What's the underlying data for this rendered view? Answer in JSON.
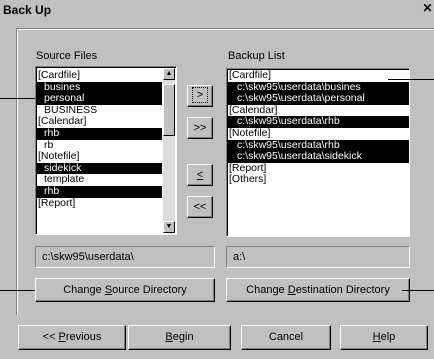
{
  "window": {
    "title": "Back Up",
    "close_glyph": "✕"
  },
  "source": {
    "label": "Source Files",
    "items": [
      {
        "text": "[Cardfile]",
        "selected": false,
        "indent": 0
      },
      {
        "text": "busines",
        "selected": true,
        "indent": 1
      },
      {
        "text": "personal",
        "selected": true,
        "indent": 1
      },
      {
        "text": "BUSINESS",
        "selected": false,
        "indent": 1
      },
      {
        "text": "[Calendar]",
        "selected": false,
        "indent": 0
      },
      {
        "text": "rhb",
        "selected": true,
        "indent": 1
      },
      {
        "text": "rb",
        "selected": false,
        "indent": 1
      },
      {
        "text": "[Notefile]",
        "selected": false,
        "indent": 0
      },
      {
        "text": "sidekick",
        "selected": true,
        "indent": 1
      },
      {
        "text": "template",
        "selected": false,
        "indent": 1
      },
      {
        "text": "rhb",
        "selected": true,
        "indent": 1
      },
      {
        "text": "[Report]",
        "selected": false,
        "indent": 0
      }
    ],
    "path": "c:\\skw95\\userdata\\",
    "change_button": {
      "before": "Change ",
      "underline": "S",
      "after": "ource Directory"
    }
  },
  "backup": {
    "label": "Backup List",
    "items": [
      {
        "text": "[Cardfile]",
        "selected": false,
        "indent": 0
      },
      {
        "text": "c:\\skw95\\userdata\\busines",
        "selected": true,
        "indent": 2
      },
      {
        "text": "c:\\skw95\\userdata\\personal",
        "selected": true,
        "indent": 2
      },
      {
        "text": "[Calendar]",
        "selected": false,
        "indent": 0
      },
      {
        "text": "c:\\skw95\\userdata\\rhb",
        "selected": true,
        "indent": 2
      },
      {
        "text": "[Notefile]",
        "selected": false,
        "indent": 0
      },
      {
        "text": "c:\\skw95\\userdata\\rhb",
        "selected": true,
        "indent": 2
      },
      {
        "text": "c:\\skw95\\userdata\\sidekick",
        "selected": true,
        "indent": 2
      },
      {
        "text": "[Report]",
        "selected": false,
        "indent": 0
      },
      {
        "text": "[Others]",
        "selected": false,
        "indent": 0
      }
    ],
    "path": "a:\\",
    "change_button": {
      "before": "Change ",
      "underline": "D",
      "after": "estination Directory"
    }
  },
  "transfer_buttons": {
    "add": ">",
    "add_all": ">>",
    "remove": "<",
    "remove_all": "<<"
  },
  "scroll_arrows": {
    "up": "▲",
    "down": "▼"
  },
  "footer": {
    "previous": {
      "before": "<< ",
      "underline": "P",
      "after": "revious"
    },
    "begin": {
      "before": "",
      "underline": "B",
      "after": "egin"
    },
    "cancel": {
      "before": "Cancel",
      "underline": "",
      "after": ""
    },
    "help": {
      "before": "",
      "underline": "H",
      "after": "elp"
    }
  }
}
